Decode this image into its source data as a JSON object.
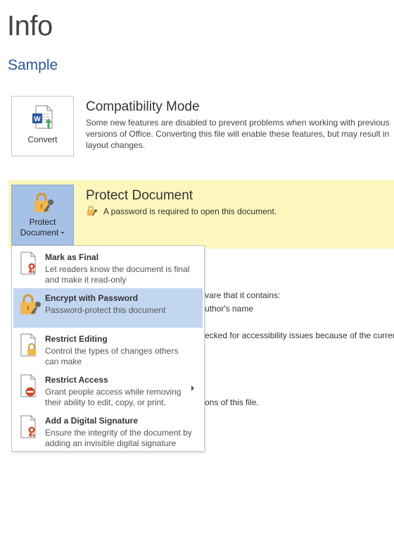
{
  "header": {
    "title": "Info",
    "doc_name": "Sample"
  },
  "compatibility": {
    "button_label": "Convert",
    "title": "Compatibility Mode",
    "description": "Some new features are disabled to prevent problems when working with previous versions of Office. Converting this file will enable these features, but may result in layout changes."
  },
  "protect": {
    "button_label_line1": "Protect",
    "button_label_line2": "Document",
    "title": "Protect Document",
    "status": "A password is required to open this document."
  },
  "background_fragments": {
    "inspect_line1": "vare that it contains:",
    "inspect_line2": "uthor's name",
    "accessibility": "ecked for accessibility issues because of the current",
    "versions": "ons of this file."
  },
  "menu": {
    "items": [
      {
        "title": "Mark as Final",
        "desc": "Let readers know the document is final and make it read-only",
        "icon": "ribbon-document-icon"
      },
      {
        "title": "Encrypt with Password",
        "desc": "Password-protect this document",
        "icon": "lock-key-icon",
        "highlighted": true
      },
      {
        "title": "Restrict Editing",
        "desc": "Control the types of changes others can make",
        "icon": "lock-document-icon"
      },
      {
        "title": "Restrict Access",
        "desc": "Grant people access while removing their ability to edit, copy, or print.",
        "icon": "no-entry-document-icon",
        "has_submenu": true
      },
      {
        "title": "Add a Digital Signature",
        "desc": "Ensure the integrity of the document by adding an invisible digital signature",
        "icon": "ribbon-document-icon"
      }
    ]
  },
  "colors": {
    "accent": "#2b579a",
    "protect_band": "#fdf6bd",
    "protect_button": "#a6c1e6",
    "menu_highlight": "#c3d6f0"
  }
}
